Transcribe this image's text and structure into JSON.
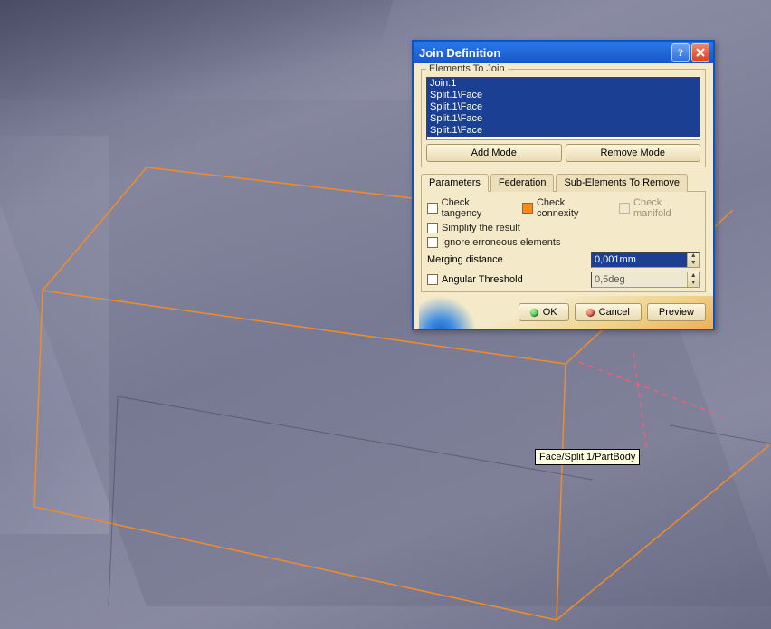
{
  "dialog": {
    "title": "Join Definition",
    "group_label": "Elements To Join",
    "list": [
      "Join.1",
      "Split.1\\Face",
      "Split.1\\Face",
      "Split.1\\Face",
      "Split.1\\Face"
    ],
    "add_mode": "Add Mode",
    "remove_mode": "Remove Mode",
    "tabs": {
      "parameters": "Parameters",
      "federation": "Federation",
      "sub_elements": "Sub-Elements To Remove"
    },
    "checks": {
      "tangency": "Check tangency",
      "connexity": "Check connexity",
      "manifold": "Check manifold",
      "simplify": "Simplify the result",
      "ignore_err": "Ignore erroneous elements"
    },
    "merging_label": "Merging distance",
    "merging_value": "0,001mm",
    "angular_label": "Angular Threshold",
    "angular_value": "0,5deg",
    "ok": "OK",
    "cancel": "Cancel",
    "preview": "Preview"
  },
  "tooltip": "Face/Split.1/PartBody"
}
